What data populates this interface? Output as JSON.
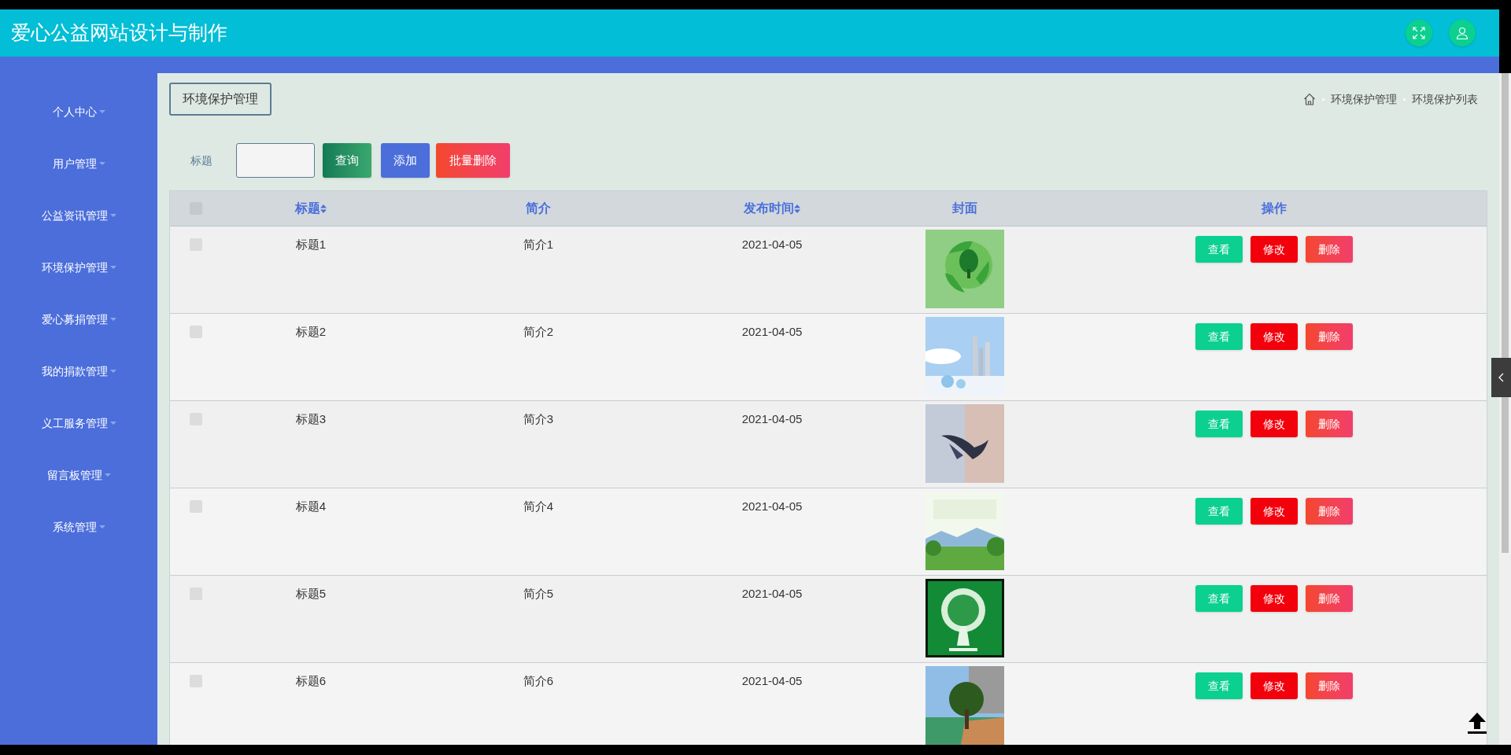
{
  "header": {
    "title": "爱心公益网站设计与制作"
  },
  "sidebar": {
    "items": [
      {
        "label": "个人中心"
      },
      {
        "label": "用户管理"
      },
      {
        "label": "公益资讯管理"
      },
      {
        "label": "环境保护管理"
      },
      {
        "label": "爱心募捐管理"
      },
      {
        "label": "我的捐款管理"
      },
      {
        "label": "义工服务管理"
      },
      {
        "label": "留言板管理"
      },
      {
        "label": "系统管理"
      }
    ]
  },
  "page_title": "环境保护管理",
  "breadcrumb": [
    "环境保护管理",
    "环境保护列表"
  ],
  "search": {
    "label": "标题",
    "buttons": [
      "查询",
      "添加",
      "批量删除"
    ]
  },
  "table": {
    "select_all_checked": false,
    "columns": [
      {
        "label": "标题",
        "sortable": true
      },
      {
        "label": "简介",
        "sortable": false
      },
      {
        "label": "发布时间",
        "sortable": true
      },
      {
        "label": "封面",
        "sortable": false
      },
      {
        "label": "操作",
        "sortable": false
      }
    ],
    "rows": [
      {
        "checked": false,
        "title": "标题1",
        "intro": "简介1",
        "date": "2021-04-05",
        "actions": [
          "查看",
          "修改",
          "删除"
        ]
      },
      {
        "checked": false,
        "title": "标题2",
        "intro": "简介2",
        "date": "2021-04-05",
        "actions": [
          "查看",
          "修改",
          "删除"
        ]
      },
      {
        "checked": false,
        "title": "标题3",
        "intro": "简介3",
        "date": "2021-04-05",
        "actions": [
          "查看",
          "修改",
          "删除"
        ]
      },
      {
        "checked": false,
        "title": "标题4",
        "intro": "简介4",
        "date": "2021-04-05",
        "actions": [
          "查看",
          "修改",
          "删除"
        ]
      },
      {
        "checked": false,
        "title": "标题5",
        "intro": "简介5",
        "date": "2021-04-05",
        "actions": [
          "查看",
          "修改",
          "删除"
        ]
      },
      {
        "checked": false,
        "title": "标题6",
        "intro": "简介6",
        "date": "2021-04-05",
        "actions": [
          "查看",
          "修改",
          "删除"
        ]
      }
    ]
  }
}
